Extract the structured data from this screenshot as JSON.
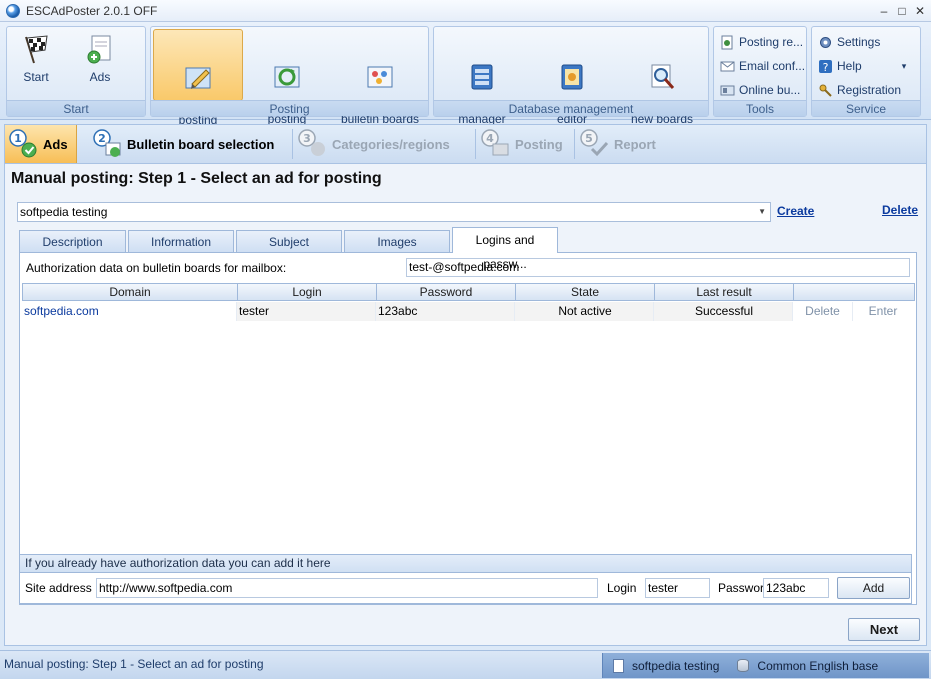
{
  "window": {
    "title": "ESCAdPoster 2.0.1 OFF",
    "minimize": "–",
    "maximize": "□",
    "close": "✕"
  },
  "ribbon": {
    "groups": {
      "start": {
        "caption": "Start",
        "start_label": "Start",
        "ads_label": "Ads"
      },
      "posting": {
        "caption": "Posting",
        "manual_label": "Manual\nposting",
        "automatic_label": "Automatic\nposting",
        "popular_label": "Popular\nbulletin boards"
      },
      "database": {
        "caption": "Database management",
        "manager_label": "Database\nmanager",
        "editor_label": "Database\neditor",
        "search_label": "Search for\nnew boards"
      },
      "tools": {
        "caption": "Tools",
        "posting_re": "Posting re...",
        "email_conf": "Email conf...",
        "online_bu": "Online bu..."
      },
      "service": {
        "caption": "Service",
        "settings": "Settings",
        "help": "Help",
        "help_arrow": "▾",
        "registration": "Registration"
      }
    }
  },
  "steps": [
    {
      "num": "1",
      "label": "Ads",
      "state": "active"
    },
    {
      "num": "2",
      "label": "Bulletin board selection",
      "state": "enabled"
    },
    {
      "num": "3",
      "label": "Categories/regions",
      "state": "disabled"
    },
    {
      "num": "4",
      "label": "Posting",
      "state": "disabled"
    },
    {
      "num": "5",
      "label": "Report",
      "state": "disabled"
    }
  ],
  "main": {
    "title": "Manual posting: Step 1 - Select an ad for posting",
    "ad_select_value": "softpedia testing",
    "create_link": "Create",
    "delete_link": "Delete",
    "tabs": [
      "Description",
      "Information",
      "Subject",
      "Images",
      "Logins and passw..."
    ],
    "auth_label": "Authorization data on bulletin boards for mailbox:",
    "auth_email": "test-@softpedia.com",
    "grid": {
      "columns": [
        "Domain",
        "Login",
        "Password",
        "State",
        "Last result"
      ],
      "rows": [
        {
          "domain": "softpedia.com",
          "login": "tester",
          "password": "123abc",
          "state": "Not active",
          "last_result": "Successful",
          "delete": "Delete",
          "enter": "Enter"
        }
      ]
    },
    "add_box": {
      "header": "If you already have authorization data you can add it here",
      "site_label": "Site address",
      "site_value": "http://www.softpedia.com",
      "login_label": "Login",
      "login_value": "tester",
      "password_label": "Password",
      "password_value": "123abc",
      "add_button": "Add"
    },
    "next_button": "Next"
  },
  "status": {
    "left": "Manual posting: Step 1 - Select an ad for posting",
    "ad_name": "softpedia testing",
    "base_name": "Common English base"
  }
}
